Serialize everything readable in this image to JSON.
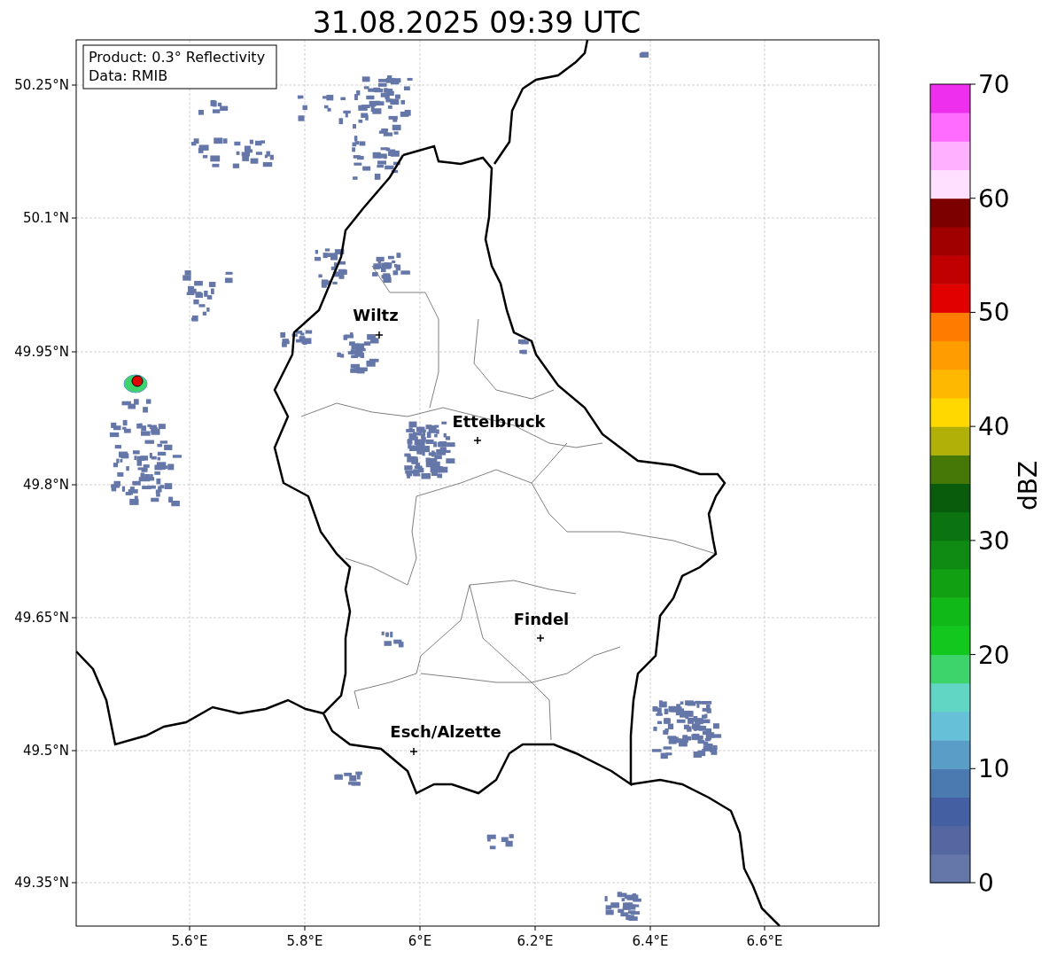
{
  "title": "31.08.2025 09:39 UTC",
  "legend": [
    "Product: 0.3° Reflectivity",
    "Data: RMIB"
  ],
  "x_ticks": [
    "5.6°E",
    "5.8°E",
    "6°E",
    "6.2°E",
    "6.4°E",
    "6.6°E"
  ],
  "y_ticks": [
    "50.25°N",
    "50.1°N",
    "49.95°N",
    "49.8°N",
    "49.65°N",
    "49.5°N",
    "49.35°N"
  ],
  "cities": [
    {
      "name": "Wiltz"
    },
    {
      "name": "Ettelbruck"
    },
    {
      "name": "Findel"
    },
    {
      "name": "Esch/Alzette"
    }
  ],
  "colorbar": {
    "label": "dBZ",
    "ticks": [
      "70",
      "60",
      "50",
      "40",
      "30",
      "20",
      "10",
      "0"
    ],
    "segments": [
      {
        "color": "#6577a8"
      },
      {
        "color": "#5467a0"
      },
      {
        "color": "#4560a2"
      },
      {
        "color": "#4a7ab0"
      },
      {
        "color": "#5a9dc6"
      },
      {
        "color": "#66c0d8"
      },
      {
        "color": "#62d6c4"
      },
      {
        "color": "#3ed46c"
      },
      {
        "color": "#12c81e"
      },
      {
        "color": "#10b818"
      },
      {
        "color": "#10a012"
      },
      {
        "color": "#0f8a12"
      },
      {
        "color": "#0b7410"
      },
      {
        "color": "#095c0c"
      },
      {
        "color": "#467808"
      },
      {
        "color": "#b0b008"
      },
      {
        "color": "#ffd800"
      },
      {
        "color": "#ffb800"
      },
      {
        "color": "#ff9c00"
      },
      {
        "color": "#ff7c00"
      },
      {
        "color": "#e00000"
      },
      {
        "color": "#c00000"
      },
      {
        "color": "#a00000"
      },
      {
        "color": "#7c0000"
      },
      {
        "color": "#ffe0ff"
      },
      {
        "color": "#ffb0ff"
      },
      {
        "color": "#ff6cff"
      },
      {
        "color": "#ee30ee"
      }
    ]
  }
}
